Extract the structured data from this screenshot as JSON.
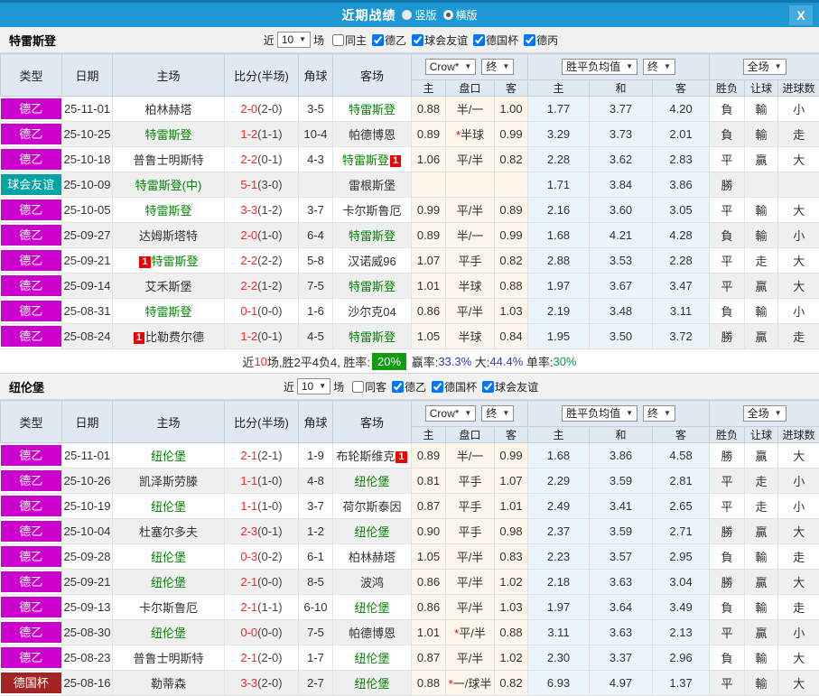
{
  "titlebar": {
    "title": "近期战绩",
    "radio_vertical": "竖版",
    "radio_horizontal": "横版",
    "close": "X"
  },
  "colors": {
    "type_badges": {
      "德乙": "#cc00cc",
      "球会友谊": "#00a2a2",
      "德国杯": "#a42424"
    },
    "result_map": {
      "勝": "r",
      "負": "g",
      "平": "b",
      "贏": "r",
      "輸": "g",
      "走": "b",
      "大": "r",
      "小": "g"
    },
    "accent_blue": "#1e97d5",
    "team_green": "#008800",
    "score_red": "#ff2222"
  },
  "table_headers": {
    "main": [
      "类型",
      "日期",
      "主场",
      "比分(半场)",
      "角球",
      "客场"
    ],
    "sub": [
      "主",
      "盘口",
      "客",
      "主",
      "和",
      "客",
      "胜负",
      "让球",
      "进球数"
    ],
    "selects": [
      "Crow*",
      "终",
      "胜平负均值",
      "终",
      "全场"
    ]
  },
  "sections": [
    {
      "team": "特雷斯登",
      "filters": {
        "near_label": "近",
        "count": "10",
        "games_label": "场",
        "same_label": "同主",
        "same_checked": false,
        "leagues": [
          {
            "label": "德乙",
            "checked": true
          },
          {
            "label": "球会友谊",
            "checked": true
          },
          {
            "label": "德国杯",
            "checked": true
          },
          {
            "label": "德丙",
            "checked": true
          }
        ]
      },
      "rows": [
        {
          "type": "德乙",
          "date": "25-11-01",
          "home": {
            "name": "柏林赫塔"
          },
          "ft": "2-0",
          "ht": "(2-0)",
          "corners": "3-5",
          "away": {
            "name": "特雷斯登",
            "green": true
          },
          "crow": [
            "0.88",
            "半/一",
            "1.00"
          ],
          "avg": [
            "1.77",
            "3.77",
            "4.20"
          ],
          "res": [
            "負",
            "輸",
            "小"
          ]
        },
        {
          "type": "德乙",
          "date": "25-10-25",
          "home": {
            "name": "特雷斯登",
            "green": true
          },
          "ft": "1-2",
          "ht": "(1-1)",
          "corners": "10-4",
          "away": {
            "name": "帕德博恩"
          },
          "crow": [
            "0.89",
            "*半球",
            "0.99"
          ],
          "avg": [
            "3.29",
            "3.73",
            "2.01"
          ],
          "res": [
            "負",
            "輸",
            "走"
          ]
        },
        {
          "type": "德乙",
          "date": "25-10-18",
          "home": {
            "name": "普鲁士明斯特"
          },
          "ft": "2-2",
          "ht": "(0-1)",
          "corners": "4-3",
          "away": {
            "name": "特雷斯登",
            "green": true,
            "badge_after": true
          },
          "crow": [
            "1.06",
            "平/半",
            "0.82"
          ],
          "avg": [
            "2.28",
            "3.62",
            "2.83"
          ],
          "res": [
            "平",
            "贏",
            "大"
          ]
        },
        {
          "type": "球会友谊",
          "date": "25-10-09",
          "home": {
            "name": "特雷斯登(中)",
            "green": true
          },
          "ft": "5-1",
          "ht": "(3-0)",
          "corners": "",
          "away": {
            "name": "雷根斯堡"
          },
          "crow": [
            "",
            "",
            ""
          ],
          "avg": [
            "1.71",
            "3.84",
            "3.86"
          ],
          "res": [
            "勝",
            "",
            ""
          ]
        },
        {
          "type": "德乙",
          "date": "25-10-05",
          "home": {
            "name": "特雷斯登",
            "green": true
          },
          "ft": "3-3",
          "ht": "(1-2)",
          "corners": "3-7",
          "away": {
            "name": "卡尔斯鲁厄"
          },
          "crow": [
            "0.99",
            "平/半",
            "0.89"
          ],
          "avg": [
            "2.16",
            "3.60",
            "3.05"
          ],
          "res": [
            "平",
            "輸",
            "大"
          ]
        },
        {
          "type": "德乙",
          "date": "25-09-27",
          "home": {
            "name": "达姆斯塔特"
          },
          "ft": "2-0",
          "ht": "(1-0)",
          "corners": "6-4",
          "away": {
            "name": "特雷斯登",
            "green": true
          },
          "crow": [
            "0.89",
            "半/一",
            "0.99"
          ],
          "avg": [
            "1.68",
            "4.21",
            "4.28"
          ],
          "res": [
            "負",
            "輸",
            "小"
          ]
        },
        {
          "type": "德乙",
          "date": "25-09-21",
          "home": {
            "name": "特雷斯登",
            "green": true,
            "badge_before": true
          },
          "ft": "2-2",
          "ht": "(2-2)",
          "corners": "5-8",
          "away": {
            "name": "汉诺威96"
          },
          "crow": [
            "1.07",
            "平手",
            "0.82"
          ],
          "avg": [
            "2.88",
            "3.53",
            "2.28"
          ],
          "res": [
            "平",
            "走",
            "大"
          ]
        },
        {
          "type": "德乙",
          "date": "25-09-14",
          "home": {
            "name": "艾禾斯堡"
          },
          "ft": "2-2",
          "ht": "(1-2)",
          "corners": "7-5",
          "away": {
            "name": "特雷斯登",
            "green": true
          },
          "crow": [
            "1.01",
            "半球",
            "0.88"
          ],
          "avg": [
            "1.97",
            "3.67",
            "3.47"
          ],
          "res": [
            "平",
            "贏",
            "大"
          ]
        },
        {
          "type": "德乙",
          "date": "25-08-31",
          "home": {
            "name": "特雷斯登",
            "green": true
          },
          "ft": "0-1",
          "ht": "(0-0)",
          "corners": "1-6",
          "away": {
            "name": "沙尔克04"
          },
          "crow": [
            "0.86",
            "平/半",
            "1.03"
          ],
          "avg": [
            "2.19",
            "3.48",
            "3.11"
          ],
          "res": [
            "負",
            "輸",
            "小"
          ]
        },
        {
          "type": "德乙",
          "date": "25-08-24",
          "home": {
            "name": "比勒费尔德",
            "badge_before": true
          },
          "ft": "1-2",
          "ht": "(0-1)",
          "corners": "4-5",
          "away": {
            "name": "特雷斯登",
            "green": true
          },
          "crow": [
            "1.05",
            "半球",
            "0.84"
          ],
          "avg": [
            "1.95",
            "3.50",
            "3.72"
          ],
          "res": [
            "勝",
            "贏",
            "走"
          ]
        }
      ],
      "summary": [
        {
          "t": "近",
          "c": "k"
        },
        {
          "t": "10",
          "c": "r"
        },
        {
          "t": "场,胜2平4负4, 胜率:",
          "c": "k"
        },
        {
          "t": "20%",
          "c": "badge"
        },
        {
          "t": " 赢率:",
          "c": "k"
        },
        {
          "t": "33.3%",
          "c": "b"
        },
        {
          "t": " 大:",
          "c": "k"
        },
        {
          "t": "44.4%",
          "c": "b"
        },
        {
          "t": " 单率:",
          "c": "k"
        },
        {
          "t": "30%",
          "c": "g"
        }
      ]
    },
    {
      "team": "纽伦堡",
      "filters": {
        "near_label": "近",
        "count": "10",
        "games_label": "场",
        "same_label": "同客",
        "same_checked": false,
        "leagues": [
          {
            "label": "德乙",
            "checked": true
          },
          {
            "label": "德国杯",
            "checked": true
          },
          {
            "label": "球会友谊",
            "checked": true
          }
        ]
      },
      "rows": [
        {
          "type": "德乙",
          "date": "25-11-01",
          "home": {
            "name": "纽伦堡",
            "green": true
          },
          "ft": "2-1",
          "ht": "(2-1)",
          "corners": "1-9",
          "away": {
            "name": "布轮斯维克",
            "badge_after": true
          },
          "crow": [
            "0.89",
            "半/一",
            "0.99"
          ],
          "avg": [
            "1.68",
            "3.86",
            "4.58"
          ],
          "res": [
            "勝",
            "贏",
            "大"
          ]
        },
        {
          "type": "德乙",
          "date": "25-10-26",
          "home": {
            "name": "凯泽斯劳滕"
          },
          "ft": "1-1",
          "ht": "(1-0)",
          "corners": "4-8",
          "away": {
            "name": "纽伦堡",
            "green": true
          },
          "crow": [
            "0.81",
            "平手",
            "1.07"
          ],
          "avg": [
            "2.29",
            "3.59",
            "2.81"
          ],
          "res": [
            "平",
            "走",
            "小"
          ]
        },
        {
          "type": "德乙",
          "date": "25-10-19",
          "home": {
            "name": "纽伦堡",
            "green": true
          },
          "ft": "1-1",
          "ht": "(1-0)",
          "corners": "3-7",
          "away": {
            "name": "荷尔斯泰因"
          },
          "crow": [
            "0.87",
            "平手",
            "1.01"
          ],
          "avg": [
            "2.49",
            "3.41",
            "2.65"
          ],
          "res": [
            "平",
            "走",
            "小"
          ]
        },
        {
          "type": "德乙",
          "date": "25-10-04",
          "home": {
            "name": "杜塞尔多夫"
          },
          "ft": "2-3",
          "ht": "(0-1)",
          "corners": "1-2",
          "away": {
            "name": "纽伦堡",
            "green": true
          },
          "crow": [
            "0.90",
            "平手",
            "0.98"
          ],
          "avg": [
            "2.37",
            "3.59",
            "2.71"
          ],
          "res": [
            "勝",
            "贏",
            "大"
          ]
        },
        {
          "type": "德乙",
          "date": "25-09-28",
          "home": {
            "name": "纽伦堡",
            "green": true
          },
          "ft": "0-3",
          "ht": "(0-2)",
          "corners": "6-1",
          "away": {
            "name": "柏林赫塔"
          },
          "crow": [
            "1.05",
            "平/半",
            "0.83"
          ],
          "avg": [
            "2.23",
            "3.57",
            "2.95"
          ],
          "res": [
            "負",
            "輸",
            "走"
          ]
        },
        {
          "type": "德乙",
          "date": "25-09-21",
          "home": {
            "name": "纽伦堡",
            "green": true
          },
          "ft": "2-1",
          "ht": "(0-0)",
          "corners": "8-5",
          "away": {
            "name": "波鸿"
          },
          "crow": [
            "0.86",
            "平/半",
            "1.02"
          ],
          "avg": [
            "2.18",
            "3.63",
            "3.04"
          ],
          "res": [
            "勝",
            "贏",
            "大"
          ]
        },
        {
          "type": "德乙",
          "date": "25-09-13",
          "home": {
            "name": "卡尔斯鲁厄"
          },
          "ft": "2-1",
          "ht": "(1-1)",
          "corners": "6-10",
          "away": {
            "name": "纽伦堡",
            "green": true
          },
          "crow": [
            "0.86",
            "平/半",
            "1.03"
          ],
          "avg": [
            "1.97",
            "3.64",
            "3.49"
          ],
          "res": [
            "負",
            "輸",
            "走"
          ]
        },
        {
          "type": "德乙",
          "date": "25-08-30",
          "home": {
            "name": "纽伦堡",
            "green": true
          },
          "ft": "0-0",
          "ht": "(0-0)",
          "corners": "7-5",
          "away": {
            "name": "帕德博恩"
          },
          "crow": [
            "1.01",
            "*平/半",
            "0.88"
          ],
          "avg": [
            "3.11",
            "3.63",
            "2.13"
          ],
          "res": [
            "平",
            "贏",
            "小"
          ]
        },
        {
          "type": "德乙",
          "date": "25-08-23",
          "home": {
            "name": "普鲁士明斯特"
          },
          "ft": "2-1",
          "ht": "(2-0)",
          "corners": "1-7",
          "away": {
            "name": "纽伦堡",
            "green": true
          },
          "crow": [
            "0.87",
            "平/半",
            "1.02"
          ],
          "avg": [
            "2.30",
            "3.37",
            "2.96"
          ],
          "res": [
            "負",
            "輸",
            "大"
          ]
        },
        {
          "type": "德国杯",
          "date": "25-08-16",
          "home": {
            "name": "勒蒂森"
          },
          "ft": "3-3",
          "ht": "(2-0)",
          "corners": "2-7",
          "away": {
            "name": "纽伦堡",
            "green": true
          },
          "crow": [
            "0.88",
            "*一/球半",
            "0.82"
          ],
          "avg": [
            "6.93",
            "4.97",
            "1.37"
          ],
          "res": [
            "平",
            "輸",
            "大"
          ]
        }
      ],
      "summary": null
    }
  ]
}
